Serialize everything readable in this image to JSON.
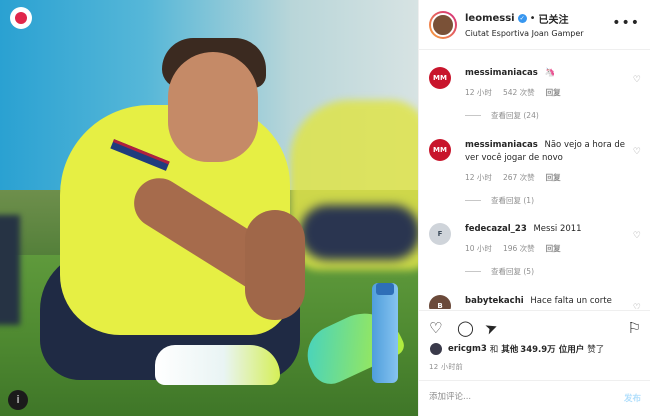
{
  "media": {
    "badge_bottom": "i"
  },
  "header": {
    "username": "leomessi",
    "separator": "•",
    "follow_label": "已关注",
    "location": "Ciutat Esportiva Joan Gamper",
    "more_icon": "•••"
  },
  "comments": [
    {
      "avatar_text": "MM",
      "user": "messimaniacas",
      "text": "🦄",
      "time": "12 小时",
      "likes": "542 次赞",
      "reply": "回复",
      "view_replies": "查看回复 (24)"
    },
    {
      "avatar_text": "MM",
      "user": "messimaniacas",
      "text": "Não vejo a hora de ver você jogar de novo",
      "time": "12 小时",
      "likes": "267 次赞",
      "reply": "回复",
      "view_replies": "查看回复 (1)"
    },
    {
      "avatar_text": "F",
      "user": "fedecazal_23",
      "text": "Messi 2011",
      "time": "10 小时",
      "likes": "196 次赞",
      "reply": "回复",
      "view_replies": "查看回复 (5)"
    },
    {
      "avatar_text": "B",
      "user": "babytekachi",
      "text": "Hace falta un corte",
      "time": "",
      "likes": "",
      "reply": "",
      "view_replies": ""
    }
  ],
  "actions": {
    "like_icon": "♡",
    "comment_icon": "◯",
    "share_icon": "➤",
    "save_icon": "⚐"
  },
  "likes": {
    "liker": "ericgm3",
    "and": "和",
    "others": "其他",
    "count": "349.9万",
    "suffix": "位用户",
    "liked": "赞了"
  },
  "timestamp": "12 小时前",
  "add_comment": {
    "placeholder": "添加评论...",
    "post_label": "发布"
  },
  "colors": {
    "accent": "#3897f0",
    "verified": "#3897f0",
    "muted": "#8e8e8e",
    "text": "#262626"
  }
}
